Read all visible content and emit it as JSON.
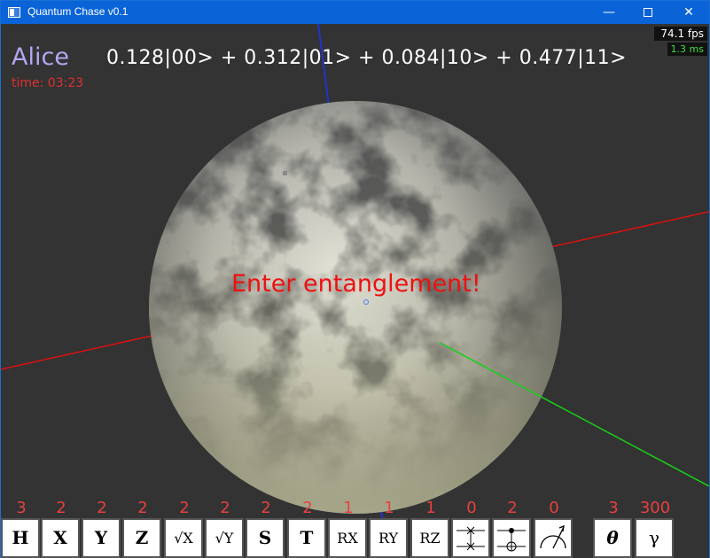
{
  "window": {
    "title": "Quantum Chase v0.1",
    "minimize": "—",
    "close": "✕"
  },
  "hud": {
    "player": "Alice",
    "timer": "time: 03:23",
    "state": "0.128|00> + 0.312|01> + 0.084|10> + 0.477|11>",
    "fps": "74.1 fps",
    "ms": "1.3 ms",
    "message": "Enter entanglement!"
  },
  "gates": [
    {
      "count": "3",
      "label": "H",
      "icon": "hadamard"
    },
    {
      "count": "2",
      "label": "X",
      "icon": "pauli-x"
    },
    {
      "count": "2",
      "label": "Y",
      "icon": "pauli-y"
    },
    {
      "count": "2",
      "label": "Z",
      "icon": "pauli-z"
    },
    {
      "count": "2",
      "label": "√X",
      "icon": "sqrt-x"
    },
    {
      "count": "2",
      "label": "√Y",
      "icon": "sqrt-y"
    },
    {
      "count": "2",
      "label": "S",
      "icon": "s-gate"
    },
    {
      "count": "2",
      "label": "T",
      "icon": "t-gate"
    },
    {
      "count": "1",
      "label": "RX",
      "icon": "rx"
    },
    {
      "count": "1",
      "label": "RY",
      "icon": "ry"
    },
    {
      "count": "1",
      "label": "RZ",
      "icon": "rz"
    },
    {
      "count": "0",
      "label": "",
      "icon": "swap"
    },
    {
      "count": "2",
      "label": "",
      "icon": "cnot"
    },
    {
      "count": "0",
      "label": "",
      "icon": "measure"
    },
    {
      "count": "3",
      "label": "θ",
      "icon": "theta"
    },
    {
      "count": "300",
      "label": "γ",
      "icon": "gamma"
    }
  ],
  "colors": {
    "background": "#333333",
    "titlebar": "#0a64d8",
    "timer": "#e03030",
    "message": "#ee1010",
    "player": "#b3a7f0",
    "counts": "#e84040"
  }
}
